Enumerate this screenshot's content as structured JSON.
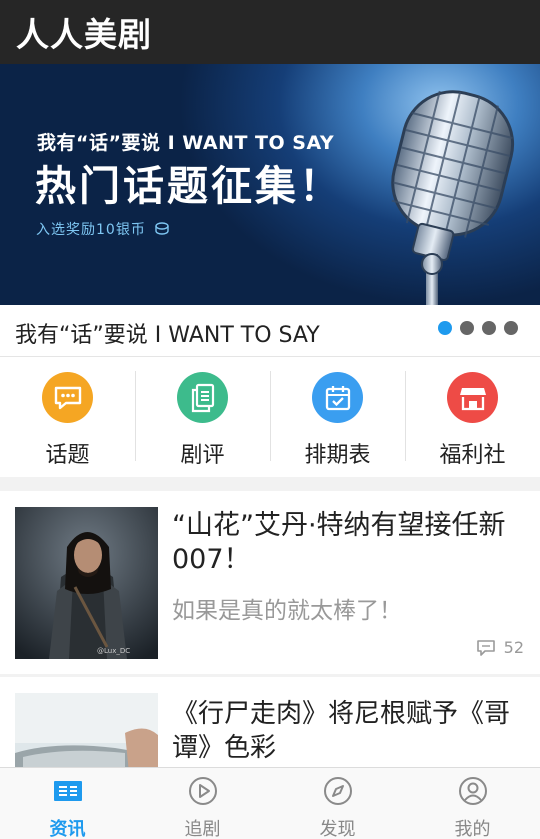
{
  "app": {
    "title": "人人美剧"
  },
  "banner": {
    "subtitle": "我有“话”要说 I WANT TO SAY",
    "headline": "热门话题征集！",
    "reward": "入选奖励10银币"
  },
  "carousel": {
    "caption": "我有“话”要说 I WANT TO SAY",
    "dots": 4,
    "active_index": 0
  },
  "shortcuts": [
    {
      "label": "话题",
      "icon": "chat-bubble-icon",
      "color": "#f5a623"
    },
    {
      "label": "剧评",
      "icon": "document-icon",
      "color": "#3dbb8c"
    },
    {
      "label": "排期表",
      "icon": "calendar-icon",
      "color": "#3a9ef0"
    },
    {
      "label": "福利社",
      "icon": "shop-icon",
      "color": "#ee4b46"
    }
  ],
  "feed": [
    {
      "title": "“山花”艾丹·特纳有望接任新007！",
      "subtitle": "如果是真的就太棒了！",
      "comments": "52",
      "thumb_credit": "@Lux_DC"
    },
    {
      "title": "《行尸走肉》将尼根赋予《哥谭》色彩"
    }
  ],
  "bottom_nav": [
    {
      "label": "资讯",
      "icon": "news-icon",
      "active": true
    },
    {
      "label": "追剧",
      "icon": "play-icon",
      "active": false
    },
    {
      "label": "发现",
      "icon": "compass-icon",
      "active": false
    },
    {
      "label": "我的",
      "icon": "user-icon",
      "active": false
    }
  ],
  "colors": {
    "accent": "#1e9aee",
    "topbar": "#262626"
  }
}
